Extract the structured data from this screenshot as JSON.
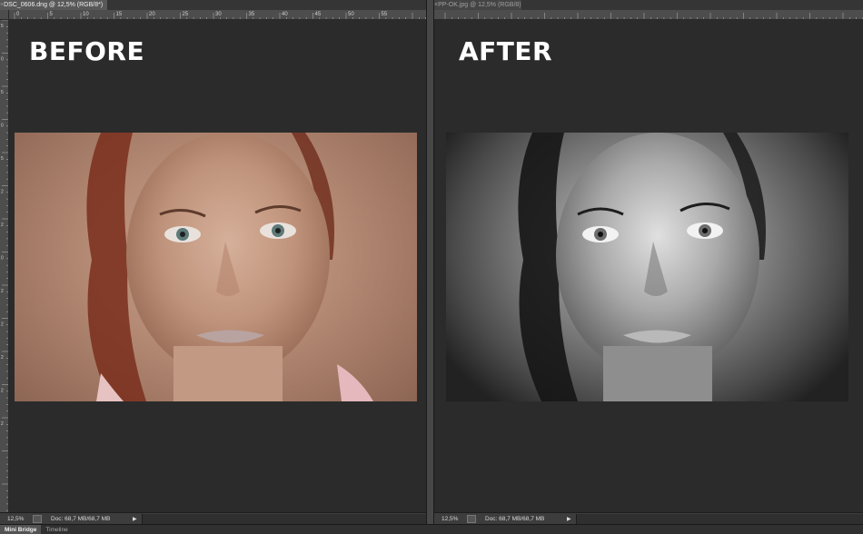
{
  "left_document": {
    "tab_title": "DSC_0606.dng @ 12,5% (RGB/8*)",
    "ruler_top_labels": [
      "0",
      "5",
      "10",
      "15",
      "20",
      "25",
      "30",
      "35",
      "40",
      "45",
      "50",
      "55"
    ],
    "ruler_side_labels": [
      "5",
      "0",
      "5",
      "0",
      "5",
      "2",
      "2",
      "0",
      "2",
      "2",
      "2",
      "2",
      "2"
    ],
    "overlay_label": "BEFORE",
    "zoom": "12,5%",
    "doc_size": "Doc: 68,7 MB/68,7 MB"
  },
  "right_document": {
    "tab_title": "PP-OK.jpg @ 12,5% (RGB/8)",
    "overlay_label": "AFTER",
    "zoom": "12,5%",
    "doc_size": "Doc: 68,7 MB/68,7 MB"
  },
  "bottom_panel": {
    "tabs": [
      "Mini Bridge",
      "Timeline"
    ]
  },
  "colors": {
    "workspace": "#2b2b2b",
    "ruler": "#4d4d4d",
    "label_text": "#ffffff"
  },
  "icons": {
    "tab_close": "×",
    "status_menu": "▶"
  }
}
